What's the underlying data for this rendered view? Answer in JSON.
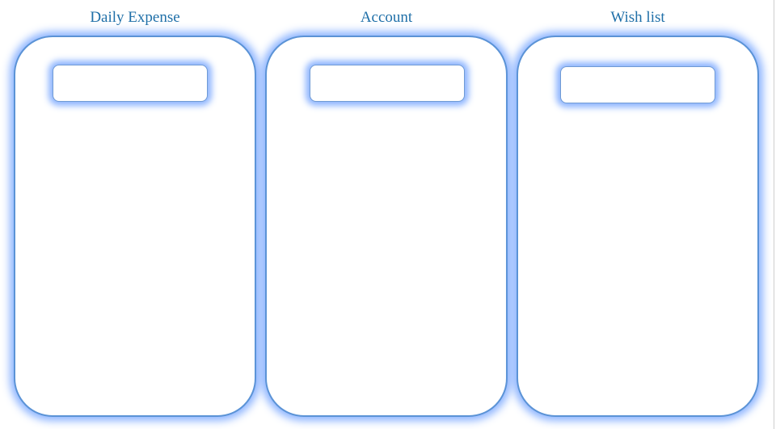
{
  "columns": [
    {
      "title": "Daily Expense",
      "input": {
        "value": "",
        "placeholder": ""
      }
    },
    {
      "title": "Account",
      "input": {
        "value": "",
        "placeholder": ""
      }
    },
    {
      "title": "Wish list",
      "input": {
        "value": "",
        "placeholder": ""
      }
    }
  ],
  "colors": {
    "title_text": "#1f6fa8",
    "card_border": "#5b93d6",
    "glow": "#7aa8ff",
    "background": "#ffffff"
  }
}
